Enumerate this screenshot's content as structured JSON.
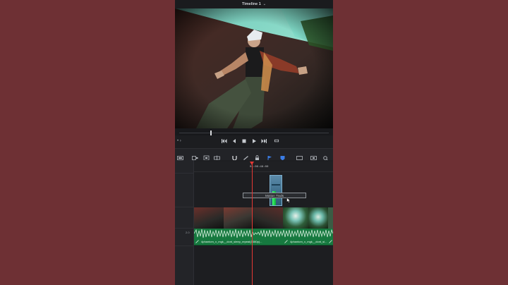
{
  "title": {
    "text": "Timeline 1",
    "chevron": "chevron-down-icon"
  },
  "timeline": {
    "timecode": "01:00:48:00",
    "fx_tooltip": "Motion Trails",
    "audio_track_label": "2.0",
    "clips": [
      {
        "name": "4phantom_x_mgk__dont_sleep_repeat(1080p)..."
      },
      {
        "name": "4phantom_x_mgk__dont_sl..."
      }
    ]
  },
  "transport": {
    "left_text": "• ›",
    "icons": [
      "skip-back-icon",
      "prev-frame-icon",
      "stop-icon",
      "play-icon",
      "skip-forward-icon",
      "loop-icon"
    ]
  },
  "toolbar": {
    "icons": [
      "selection-mode-icon",
      "trim-icon",
      "dynamic-trim-icon",
      "blade-icon",
      "snapping-icon",
      "linked-selection-icon",
      "lock-icon",
      "flag-icon",
      "marker-icon",
      "zoom-full-icon",
      "zoom-detail-icon",
      "search-icon"
    ]
  },
  "colors": {
    "background": "#6e3034",
    "app": "#1c1d20",
    "playhead": "#e53935",
    "audio": "#16793f",
    "accent_blue": "#3b7de6"
  }
}
